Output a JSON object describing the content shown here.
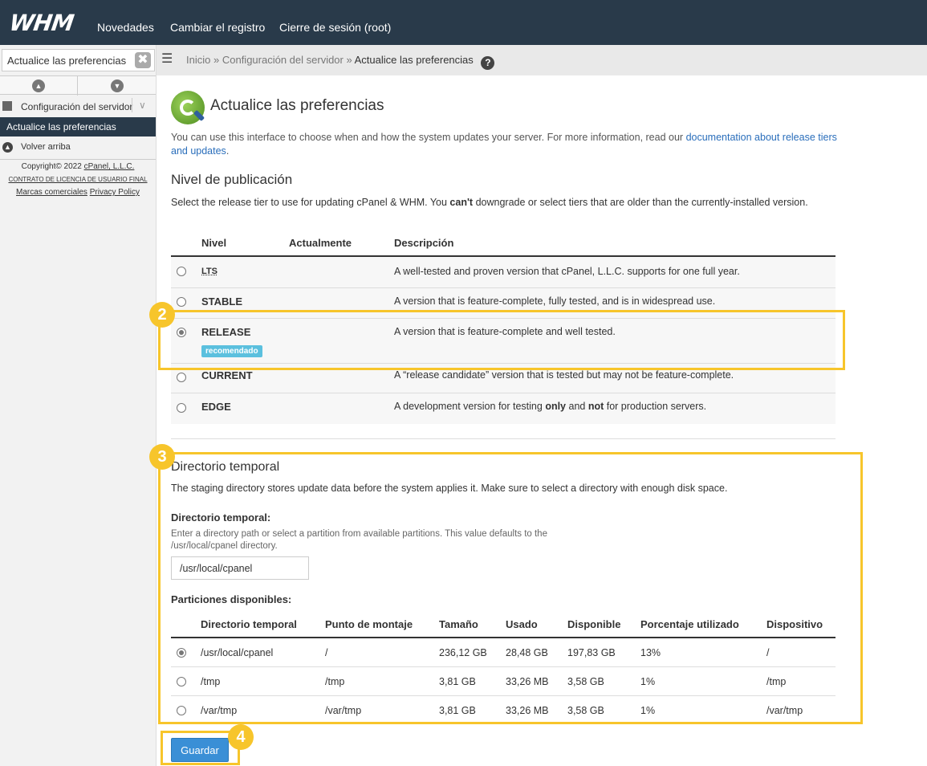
{
  "topbar": {
    "logo": "WHM",
    "nav": [
      "Novedades",
      "Cambiar el registro",
      "Cierre de sesión (root)"
    ]
  },
  "sidebar": {
    "search_value": "Actualice las preferencias",
    "clear_glyph": "✖",
    "category": "Configuración del servidor",
    "active_item": "Actualice las preferencias",
    "back_label": "Volver arriba",
    "footer": {
      "copyright": "Copyright© 2022",
      "company": "cPanel, L.L.C.",
      "eula": "CONTRATO DE LICENCIA DE USUARIO FINAL",
      "trademarks": "Marcas comerciales",
      "privacy": "Privacy Policy"
    }
  },
  "breadcrumb": {
    "items": [
      "Inicio",
      "Configuración del servidor",
      "Actualice las preferencias"
    ],
    "separator": "»",
    "help": "?"
  },
  "page": {
    "title": "Actualice las preferencias",
    "intro_text": "You can use this interface to choose when and how the system updates your server. For more information, read our ",
    "intro_link": "documentation about release tiers and updates",
    "intro_end": "."
  },
  "publication": {
    "title": "Nivel de publicación",
    "desc_part1": "Select the release tier to use for updating cPanel & WHM. You ",
    "desc_bold": "can't",
    "desc_part2": " downgrade or select tiers that are older than the currently-installed version.",
    "headers": [
      "Nivel",
      "Actualmente",
      "Descripción"
    ],
    "tiers": [
      {
        "name": "LTS",
        "desc": "A well-tested and proven version that cPanel, L.L.C. supports for one full year.",
        "selected": false
      },
      {
        "name": "STABLE",
        "desc": "A version that is feature-complete, fully tested, and is in widespread use.",
        "selected": false
      },
      {
        "name": "RELEASE",
        "desc": "A version that is feature-complete and well tested.",
        "selected": true,
        "badge": "recomendado"
      },
      {
        "name": "CURRENT",
        "desc": "A “release candidate” version that is tested but may not be feature-complete.",
        "selected": false
      },
      {
        "name": "EDGE",
        "desc_a": "A development version for testing ",
        "desc_b": "only",
        "desc_c": " and ",
        "desc_d": "not",
        "desc_e": " for production servers.",
        "selected": false
      }
    ]
  },
  "staging": {
    "title": "Directorio temporal",
    "desc": "The staging directory stores update data before the system applies it. Make sure to select a directory with enough disk space.",
    "field_label": "Directorio temporal:",
    "field_help": "Enter a directory path or select a partition from available partitions. This value defaults to the /usr/local/cpanel directory.",
    "field_value": "/usr/local/cpanel",
    "partitions_label": "Particiones disponibles:",
    "headers": [
      "Directorio temporal",
      "Punto de montaje",
      "Tamaño",
      "Usado",
      "Disponible",
      "Porcentaje utilizado",
      "Dispositivo"
    ],
    "rows": [
      {
        "dir": "/usr/local/cpanel",
        "mount": "/",
        "size": "236,12 GB",
        "used": "28,48 GB",
        "avail": "197,83 GB",
        "pct": "13%",
        "device": "/",
        "selected": true
      },
      {
        "dir": "/tmp",
        "mount": "/tmp",
        "size": "3,81 GB",
        "used": "33,26 MB",
        "avail": "3,58 GB",
        "pct": "1%",
        "device": "/tmp",
        "selected": false
      },
      {
        "dir": "/var/tmp",
        "mount": "/var/tmp",
        "size": "3,81 GB",
        "used": "33,26 MB",
        "avail": "3,58 GB",
        "pct": "1%",
        "device": "/var/tmp",
        "selected": false
      }
    ]
  },
  "save_label": "Guardar",
  "annotations": {
    "steps": [
      "2",
      "3",
      "4"
    ],
    "color": "#f7c52b"
  },
  "colors": {
    "topbar": "#293a4a",
    "link": "#2a6ebb",
    "button": "#3a8fd6",
    "badge": "#5bc0de"
  }
}
